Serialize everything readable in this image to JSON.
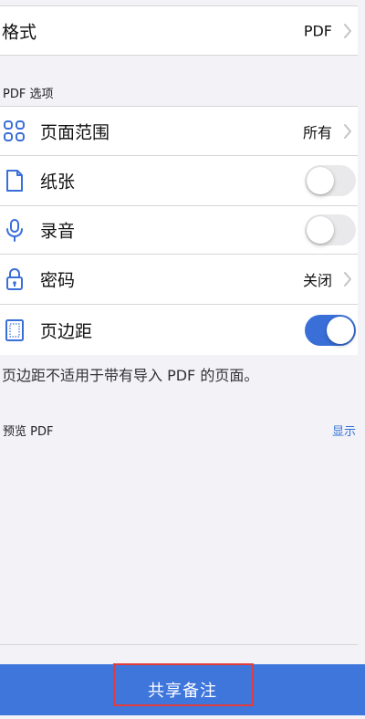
{
  "format_row": {
    "label": "格式",
    "value": "PDF"
  },
  "pdf_options_header": "PDF 选项",
  "options": {
    "page_range": {
      "label": "页面范围",
      "value": "所有"
    },
    "paper": {
      "label": "纸张",
      "toggle_on": false
    },
    "recording": {
      "label": "录音",
      "toggle_on": false
    },
    "password": {
      "label": "密码",
      "value": "关闭"
    },
    "margins": {
      "label": "页边距",
      "toggle_on": true
    }
  },
  "margins_note": "页边距不适用于带有导入 PDF 的页面。",
  "preview": {
    "label": "预览 PDF",
    "action": "显示"
  },
  "share_button": {
    "label": "共享备注"
  },
  "colors": {
    "accent": "#3F76DC",
    "toggle_on": "#3A6FD8",
    "link": "#2F6FD6",
    "highlight_border": "#E23B3B"
  },
  "icons": {
    "page_range": "grid-icon",
    "paper": "document-icon",
    "recording": "microphone-icon",
    "password": "lock-icon",
    "margins": "page-margins-icon",
    "chevron": "chevron-right-icon"
  }
}
